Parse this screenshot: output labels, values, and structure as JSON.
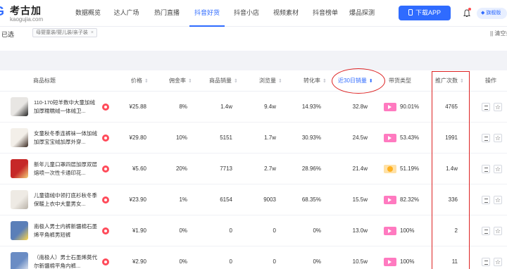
{
  "brand": {
    "name": "考古加",
    "domain": "kaogujia.com",
    "mark": "G"
  },
  "nav": [
    {
      "label": "数据概览",
      "width": 50,
      "active": false
    },
    {
      "label": "达人广场",
      "width": 59,
      "active": false
    },
    {
      "label": "热门直播",
      "width": 56,
      "active": false
    },
    {
      "label": "抖音好货",
      "width": 58,
      "active": true
    },
    {
      "label": "抖音小店",
      "width": 54,
      "active": false
    },
    {
      "label": "视频素材",
      "width": 58,
      "active": false
    },
    {
      "label": "抖音榜单",
      "width": 54,
      "active": false
    },
    {
      "label": "爆品探测",
      "width": 50,
      "active": false
    }
  ],
  "download_label": "下载APP",
  "vip_label": "旗舰版",
  "filter": {
    "selected_label": "已选",
    "tag": "母婴童装/婴儿装/亲子装",
    "clear_label": "|| 清空条件"
  },
  "table": {
    "columns": {
      "title": "商品标题",
      "price": "价格",
      "commission": "佣金率",
      "sales": "商品销量",
      "views": "浏览量",
      "conversion": "转化率",
      "sales30": "近30日销量",
      "type": "带货类型",
      "promos": "推广次数",
      "actions": "操作"
    },
    "rows": [
      {
        "title": "110-170短羊数中大童加绒加厚糯糯绒一体绒卫...",
        "price": "¥25.88",
        "commission": "8%",
        "sales": "1.4w",
        "views": "9.4w",
        "conversion": "14.93%",
        "sales30": "32.8w",
        "type": "video",
        "type_pct": "90.01%",
        "promos": "4765",
        "thumb": [
          "#e8e6e3",
          "#222"
        ]
      },
      {
        "title": "女童秋冬季连裤袜一体加绒加厚宝宝绒加厚外穿...",
        "price": "¥29.80",
        "commission": "10%",
        "sales": "5151",
        "views": "1.7w",
        "conversion": "30.93%",
        "sales30": "24.5w",
        "type": "video",
        "type_pct": "53.43%",
        "promos": "1991",
        "thumb": [
          "#f3efe9",
          "#3a2a22"
        ]
      },
      {
        "title": "新年儿童口罩四层加厚双层熔喷一次性卡通印花...",
        "price": "¥5.60",
        "commission": "20%",
        "sales": "7713",
        "views": "2.7w",
        "conversion": "28.96%",
        "sales30": "21.4w",
        "type": "live",
        "type_pct": "51.19%",
        "promos": "1.4w",
        "thumb": [
          "#c62828",
          "#f4d27a"
        ]
      },
      {
        "title": "儿童德绒中领打底衫秋冬季保暖上衣中大童男女...",
        "price": "¥23.90",
        "commission": "1%",
        "sales": "6154",
        "views": "9003",
        "conversion": "68.35%",
        "sales30": "15.5w",
        "type": "video",
        "type_pct": "82.32%",
        "promos": "336",
        "thumb": [
          "#eeeae4",
          "#b9b2a8"
        ]
      },
      {
        "title": "南极人男士内裤新疆棉石墨烯平角裤男短裤",
        "price": "¥1.90",
        "commission": "0%",
        "sales": "0",
        "views": "0",
        "conversion": "0%",
        "sales30": "13.0w",
        "type": "video",
        "type_pct": "100%",
        "promos": "2",
        "thumb": [
          "#5b7fb8",
          "#ffd84a"
        ]
      },
      {
        "title": "（南极人）男士石墨烯莫代尔新疆棉平角内裤...",
        "price": "¥2.90",
        "commission": "0%",
        "sales": "0",
        "views": "0",
        "conversion": "0%",
        "sales30": "10.5w",
        "type": "video",
        "type_pct": "100%",
        "promos": "11",
        "thumb": [
          "#6a8cc4",
          "#e5e9f2"
        ]
      }
    ]
  },
  "colors": {
    "accent": "#2f6bff",
    "annotation": "#dd2222",
    "page_bg": "#f2f3f7"
  }
}
